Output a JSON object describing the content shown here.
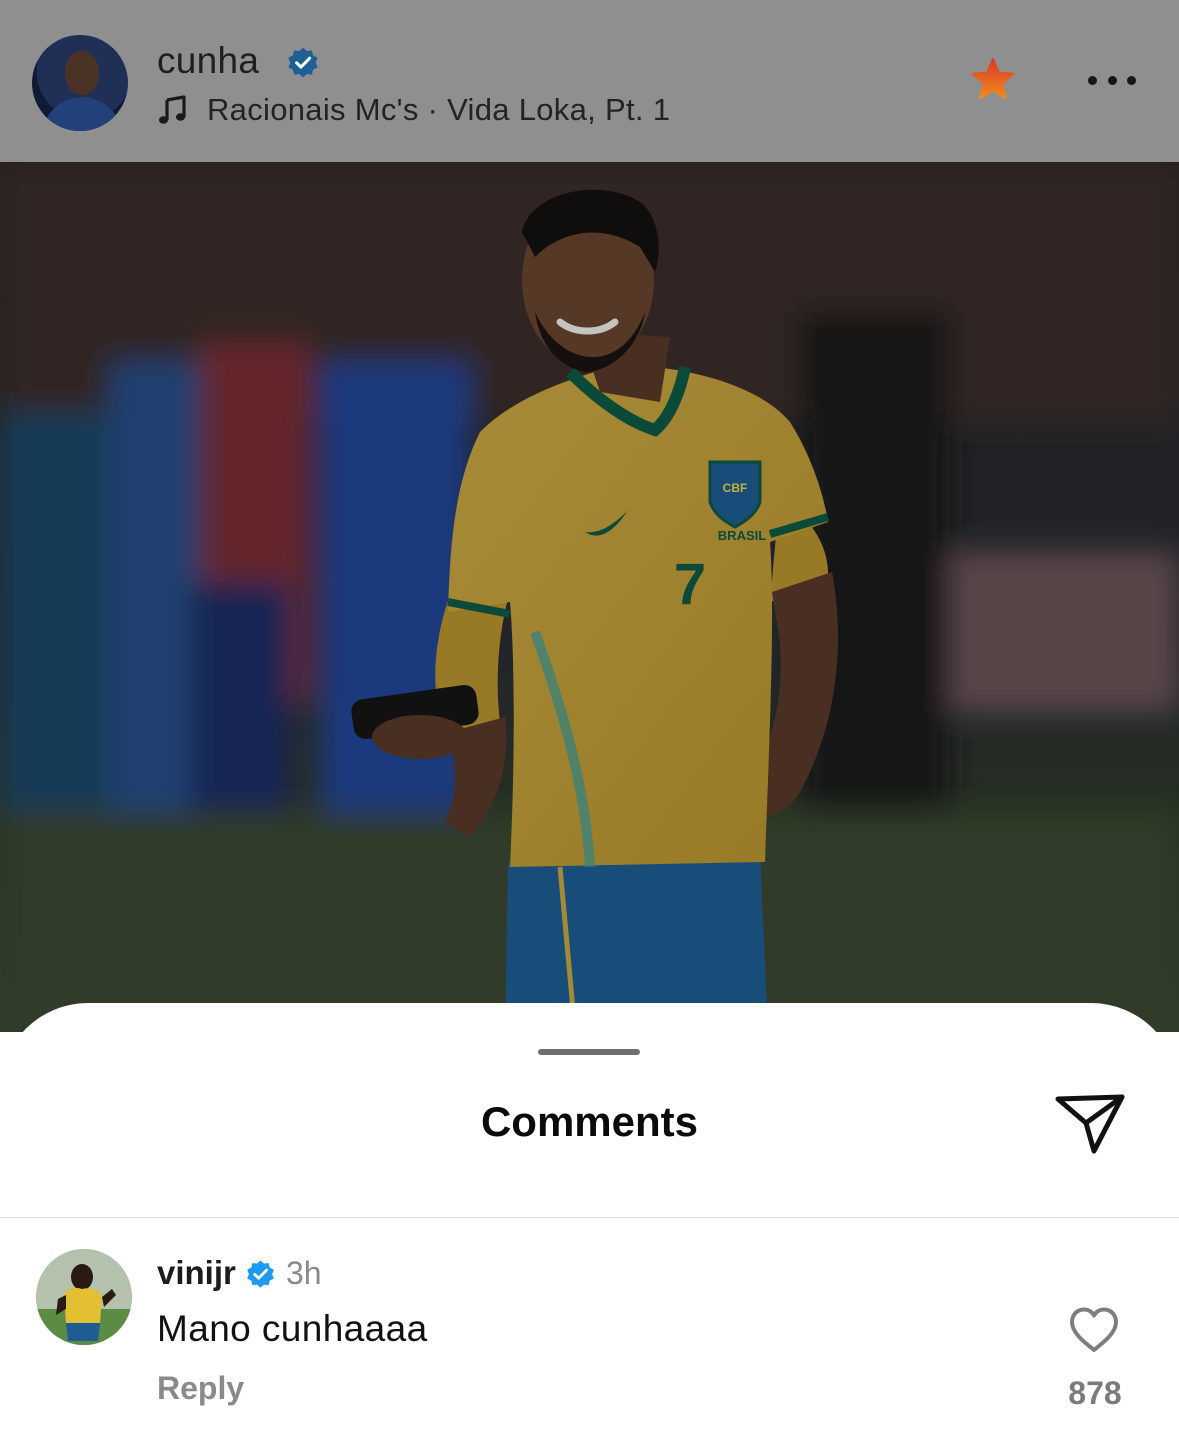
{
  "post": {
    "username": "cunha",
    "verified": true,
    "music": "Racionais Mc's · Vida Loka, Pt. 1",
    "icons": {
      "music": "music-note-icon",
      "favorite": "star-icon",
      "more": "more-options-icon"
    },
    "image": {
      "subject": "football player",
      "jersey_number": "7",
      "jersey_text": "BRASIL",
      "crest_text": "CBF"
    }
  },
  "comments_sheet": {
    "title": "Comments",
    "share_icon": "send-icon",
    "comments": [
      {
        "username": "vinijr",
        "verified": true,
        "time": "3h",
        "text": "Mano cunhaaaa",
        "reply_label": "Reply",
        "likes": "878"
      }
    ]
  },
  "colors": {
    "verified": "#1d9bf0",
    "header_dim": "#8f8f8f",
    "star_top": "#d93a2a",
    "star_bottom": "#f28a1c",
    "jersey_yellow": "#d9b54a",
    "jersey_green": "#0e5a45",
    "shorts_blue": "#1f6fb0"
  }
}
